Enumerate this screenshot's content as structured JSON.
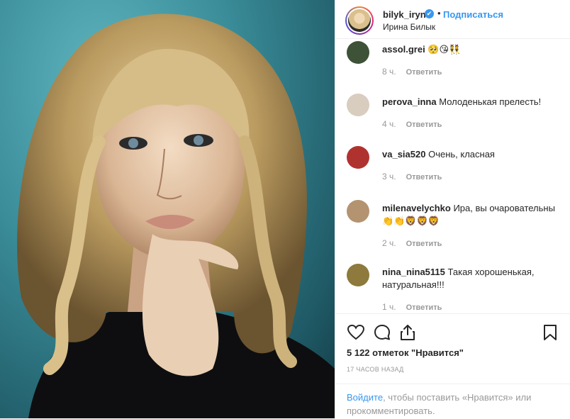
{
  "header": {
    "username": "bilyk_iryna",
    "verified_mark": "✔",
    "separator": "•",
    "follow_label": "Подписаться",
    "full_name": "Ирина Билык"
  },
  "comments": [
    {
      "user": "assol.grei",
      "text": "🥺😘👯",
      "time": "8 ч.",
      "reply": "Ответить",
      "avatar_color": "#3d5236"
    },
    {
      "user": "perova_inna",
      "text": "Молоденькая прелесть!",
      "time": "4 ч.",
      "reply": "Ответить",
      "avatar_color": "#d8cdbf"
    },
    {
      "user": "va_sia520",
      "text": "Очень, класная",
      "time": "3 ч.",
      "reply": "Ответить",
      "avatar_color": "#b0322f"
    },
    {
      "user": "milenavelychko",
      "text": "Ира, вы очаровательны👏👏🦁🦁🦁",
      "time": "2 ч.",
      "reply": "Ответить",
      "avatar_color": "#b49370"
    },
    {
      "user": "nina_nina5115",
      "text": "Такая хорошенькая, натуральная!!!",
      "time": "1 ч.",
      "reply": "Ответить",
      "avatar_color": "#8d7a3c"
    }
  ],
  "actions": {
    "like_icon": "heart-icon",
    "comment_icon": "comment-icon",
    "share_icon": "share-icon",
    "save_icon": "bookmark-icon",
    "likes_text": "5 122 отметок \"Нравится\"",
    "time_ago": "17 ЧАСОВ НАЗАД"
  },
  "login_prompt": {
    "link": "Войдите",
    "rest": ", чтобы поставить «Нравится» или прокомментировать."
  },
  "colors": {
    "accent": "#3897f0",
    "text": "#262626",
    "muted": "#999999",
    "border": "#efefef"
  }
}
